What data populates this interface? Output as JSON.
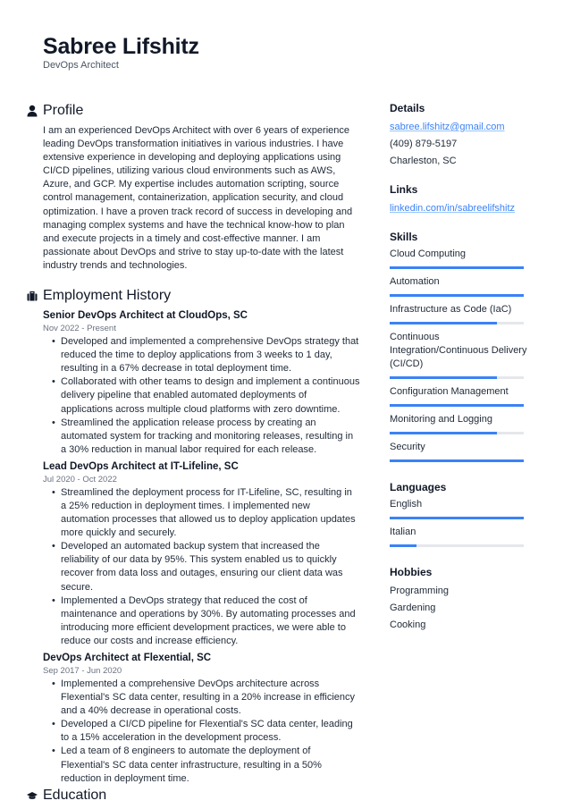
{
  "header": {
    "name": "Sabree Lifshitz",
    "title": "DevOps Architect"
  },
  "profile": {
    "heading": "Profile",
    "icon": "user-icon",
    "text": "I am an experienced DevOps Architect with over 6 years of experience leading DevOps transformation initiatives in various industries. I have extensive experience in developing and deploying applications using CI/CD pipelines, utilizing various cloud environments such as AWS, Azure, and GCP. My expertise includes automation scripting, source control management, containerization, application security, and cloud optimization. I have a proven track record of success in developing and managing complex systems and have the technical know-how to plan and execute projects in a timely and cost-effective manner. I am passionate about DevOps and strive to stay up-to-date with the latest industry trends and technologies."
  },
  "employment": {
    "heading": "Employment History",
    "icon": "briefcase-icon",
    "jobs": [
      {
        "title": "Senior DevOps Architect at CloudOps, SC",
        "dates": "Nov 2022 - Present",
        "bullets": [
          "Developed and implemented a comprehensive DevOps strategy that reduced the time to deploy applications from 3 weeks to 1 day, resulting in a 67% decrease in total deployment time.",
          "Collaborated with other teams to design and implement a continuous delivery pipeline that enabled automated deployments of applications across multiple cloud platforms with zero downtime.",
          "Streamlined the application release process by creating an automated system for tracking and monitoring releases, resulting in a 30% reduction in manual labor required for each release."
        ]
      },
      {
        "title": "Lead DevOps Architect at IT-Lifeline, SC",
        "dates": "Jul 2020 - Oct 2022",
        "bullets": [
          "Streamlined the deployment process for IT-Lifeline, SC, resulting in a 25% reduction in deployment times. I implemented new automation processes that allowed us to deploy application updates more quickly and securely.",
          "Developed an automated backup system that increased the reliability of our data by 95%. This system enabled us to quickly recover from data loss and outages, ensuring our client data was secure.",
          "Implemented a DevOps strategy that reduced the cost of maintenance and operations by 30%. By automating processes and introducing more efficient development practices, we were able to reduce our costs and increase efficiency."
        ]
      },
      {
        "title": "DevOps Architect at Flexential, SC",
        "dates": "Sep 2017 - Jun 2020",
        "bullets": [
          "Implemented a comprehensive DevOps architecture across Flexential's SC data center, resulting in a 20% increase in efficiency and a 40% decrease in operational costs.",
          "Developed a CI/CD pipeline for Flexential's SC data center, leading to a 15% acceleration in the development process.",
          "Led a team of 8 engineers to automate the deployment of Flexential's SC data center infrastructure, resulting in a 50% reduction in deployment time."
        ]
      }
    ]
  },
  "education": {
    "heading": "Education",
    "icon": "graduation-cap-icon"
  },
  "sidebar": {
    "details": {
      "heading": "Details",
      "email": "sabree.lifshitz@gmail.com",
      "phone": "(409) 879-5197",
      "location": "Charleston, SC"
    },
    "links": {
      "heading": "Links",
      "items": [
        "linkedin.com/in/sabreelifshitz"
      ]
    },
    "skills": {
      "heading": "Skills",
      "items": [
        {
          "label": "Cloud Computing",
          "level": 1.0
        },
        {
          "label": "Automation",
          "level": 1.0
        },
        {
          "label": "Infrastructure as Code (IaC)",
          "level": 0.8
        },
        {
          "label": "Continuous Integration/Continuous Delivery (CI/CD)",
          "level": 0.8
        },
        {
          "label": "Configuration Management",
          "level": 1.0
        },
        {
          "label": "Monitoring and Logging",
          "level": 0.8
        },
        {
          "label": "Security",
          "level": 1.0
        }
      ]
    },
    "languages": {
      "heading": "Languages",
      "items": [
        {
          "label": "English",
          "level": 1.0
        },
        {
          "label": "Italian",
          "level": 0.2
        }
      ]
    },
    "hobbies": {
      "heading": "Hobbies",
      "items": [
        "Programming",
        "Gardening",
        "Cooking"
      ]
    }
  },
  "colors": {
    "accent": "#3b82f6",
    "bar_track": "#e5e7eb",
    "text": "#1f2937",
    "muted": "#6b7280"
  }
}
